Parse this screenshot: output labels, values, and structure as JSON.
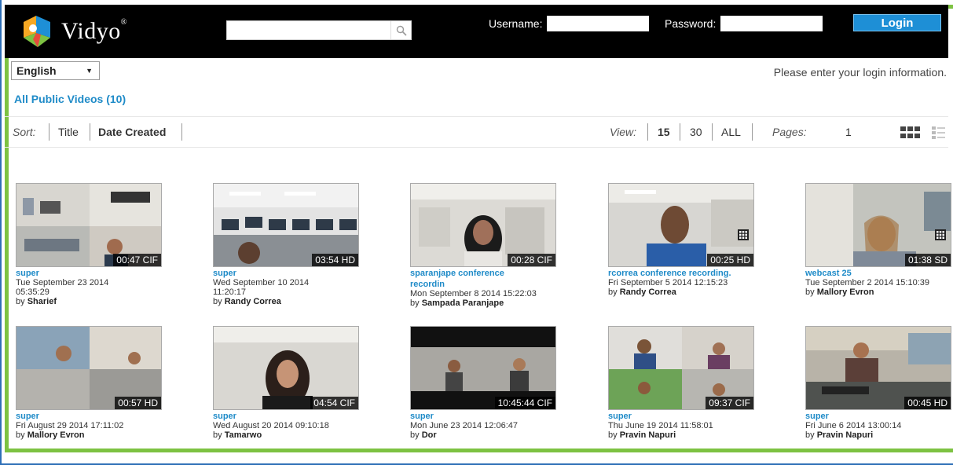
{
  "header": {
    "logo_text": "Vidyo",
    "search_placeholder": "",
    "username_label": "Username:",
    "password_label": "Password:",
    "login_button": "Login"
  },
  "lang": {
    "selected": "English"
  },
  "login_message": "Please enter your login information.",
  "all_public_videos": "All Public Videos (10)",
  "sort": {
    "label": "Sort:",
    "title": "Title",
    "date_created": "Date Created"
  },
  "view": {
    "label": "View:",
    "opt15": "15",
    "opt30": "30",
    "optall": "ALL"
  },
  "pages": {
    "label": "Pages:",
    "current": "1"
  },
  "by_prefix": "by",
  "videos": [
    {
      "title": "super",
      "title2": "",
      "date": "Tue September 23 2014",
      "date2": "05:35:29",
      "by": "Sharief",
      "duration": "00:47 CIF",
      "multi": false
    },
    {
      "title": "super",
      "title2": "",
      "date": "Wed September 10 2014",
      "date2": "11:20:17",
      "by": "Randy Correa",
      "duration": "03:54 HD",
      "multi": false
    },
    {
      "title": "sparanjape conference",
      "title2": "recordin",
      "date": "Mon September 8 2014 15:22:03",
      "date2": "",
      "by": "Sampada Paranjape",
      "duration": "00:28 CIF",
      "multi": false
    },
    {
      "title": "rcorrea conference recording.",
      "title2": "",
      "date": "Fri September 5 2014 12:15:23",
      "date2": "",
      "by": "Randy Correa",
      "duration": "00:25 HD",
      "multi": true
    },
    {
      "title": "webcast 25",
      "title2": "",
      "date": "Tue September 2 2014 15:10:39",
      "date2": "",
      "by": "Mallory Evron",
      "duration": "01:38 SD",
      "multi": true
    },
    {
      "title": "super",
      "title2": "",
      "date": "Fri August 29 2014 17:11:02",
      "date2": "",
      "by": "Mallory Evron",
      "duration": "00:57 HD",
      "multi": false
    },
    {
      "title": "super",
      "title2": "",
      "date": "Wed August 20 2014 09:10:18",
      "date2": "",
      "by": "Tamarwo",
      "duration": "04:54 CIF",
      "multi": false
    },
    {
      "title": "super",
      "title2": "",
      "date": "Mon June 23 2014 12:06:47",
      "date2": "",
      "by": "Dor",
      "duration": "10:45:44 CIF",
      "multi": false
    },
    {
      "title": "super",
      "title2": "",
      "date": "Thu June 19 2014 11:58:01",
      "date2": "",
      "by": "Pravin Napuri",
      "duration": "09:37 CIF",
      "multi": false
    },
    {
      "title": "super",
      "title2": "",
      "date": "Fri June 6 2014 13:00:14",
      "date2": "",
      "by": "Pravin Napuri",
      "duration": "00:45 HD",
      "multi": false
    }
  ]
}
